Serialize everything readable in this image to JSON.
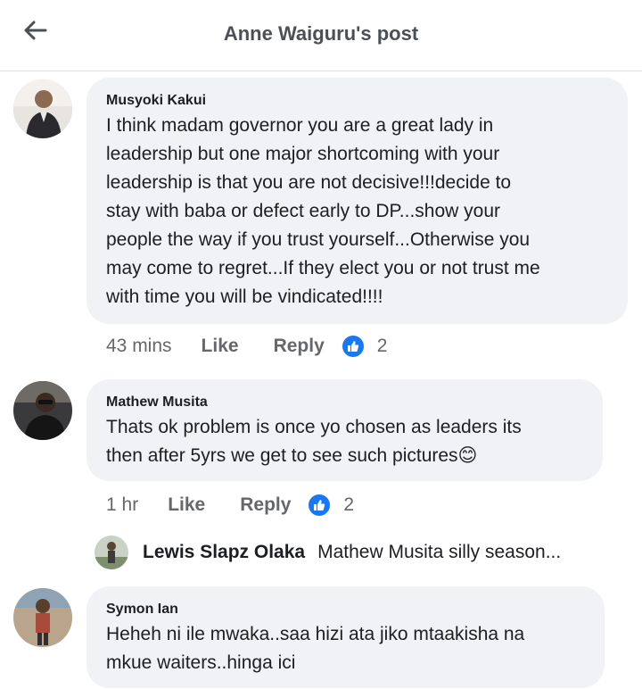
{
  "header": {
    "title": "Anne Waiguru's post",
    "back_icon": "arrow-left-icon"
  },
  "comments": [
    {
      "author": "Musyoki Kakui",
      "text": "I think madam governor you are a great lady in\nleadership but one major shortcoming with your\nleadership is that you are not decisive!!!decide to\nstay with baba or defect early to DP...show your\npeople the way if you trust yourself...Otherwise you\nmay come to regret...If they elect you or not trust me\nwith time you will be vindicated!!!!",
      "time": "43 mins",
      "like_label": "Like",
      "reply_label": "Reply",
      "reaction_icon": "thumbs-up-icon",
      "reaction_count": "2"
    },
    {
      "author": "Mathew Musita",
      "text": "Thats ok problem is once yo chosen as leaders its\nthen after 5yrs we get to see such pictures😊",
      "time": "1 hr",
      "like_label": "Like",
      "reply_label": "Reply",
      "reaction_icon": "thumbs-up-icon",
      "reaction_count": "2"
    },
    {
      "author": "Symon Ian",
      "text": "Heheh ni ile mwaka..saa hizi ata jiko mtaakisha na\nmkue waiters..hinga ici"
    }
  ],
  "reply_preview": {
    "author": "Lewis Slapz Olaka",
    "snippet": "Mathew Musita silly season..."
  },
  "colors": {
    "bubble": "#f0f2f5",
    "accent": "#1877f2",
    "secondary_text": "#65676b"
  }
}
